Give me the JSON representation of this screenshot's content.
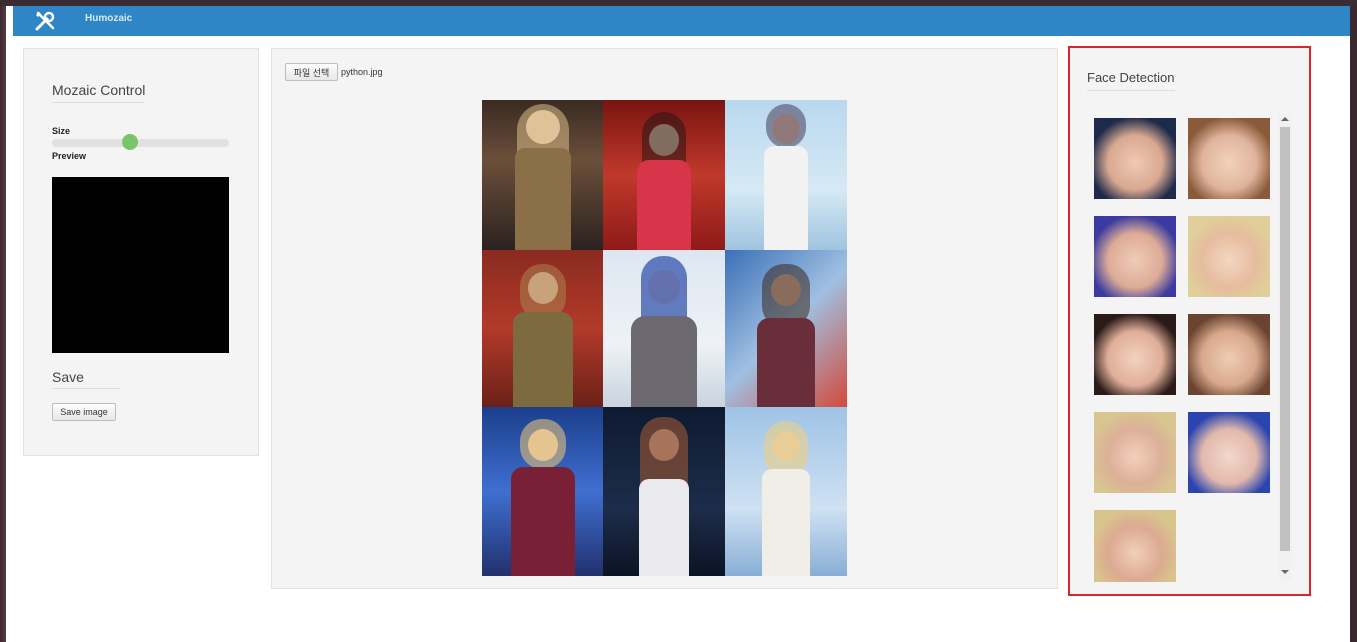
{
  "app": {
    "brand": "Humozaic",
    "logo_icon": "tools-icon"
  },
  "left": {
    "heading": "Mozaic Control",
    "size_label": "Size",
    "size_value": 0.44,
    "preview_label": "Preview",
    "save_heading": "Save",
    "save_button": "Save image"
  },
  "center": {
    "file_button": "파일 선택",
    "file_name": "python.jpg"
  },
  "right": {
    "heading": "Face Detection"
  },
  "colors": {
    "navbar": "#2f86c6",
    "highlight_border": "#d9262c",
    "slider_thumb": "#7cc46c"
  }
}
